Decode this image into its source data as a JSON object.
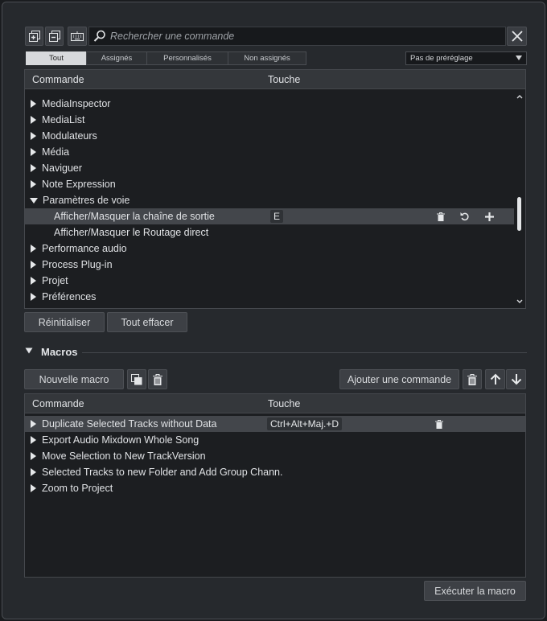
{
  "toolbar": {
    "search_placeholder": "Rechercher une commande"
  },
  "filter_tabs": [
    {
      "label": "Tout",
      "active": true
    },
    {
      "label": "Assignés",
      "active": false
    },
    {
      "label": "Personnalisés",
      "active": false
    },
    {
      "label": "Non assignés",
      "active": false
    }
  ],
  "preset": {
    "selected": "Pas de préréglage"
  },
  "commands_table": {
    "col_command": "Commande",
    "col_key": "Touche",
    "rows": [
      {
        "label": "MediaInspector",
        "expanded": false
      },
      {
        "label": "MediaList",
        "expanded": false
      },
      {
        "label": "Modulateurs",
        "expanded": false
      },
      {
        "label": "Média",
        "expanded": false
      },
      {
        "label": "Naviguer",
        "expanded": false
      },
      {
        "label": "Note Expression",
        "expanded": false
      },
      {
        "label": "Paramètres de voie",
        "expanded": true
      },
      {
        "label": "Afficher/Masquer la chaîne de sortie",
        "child": true,
        "selected": true,
        "key": "E"
      },
      {
        "label": "Afficher/Masquer le Routage direct",
        "child": true
      },
      {
        "label": "Performance audio",
        "expanded": false
      },
      {
        "label": "Process Plug-in",
        "expanded": false
      },
      {
        "label": "Projet",
        "expanded": false
      },
      {
        "label": "Préférences",
        "expanded": false
      }
    ]
  },
  "command_actions": {
    "reset_label": "Réinitialiser",
    "clear_all_label": "Tout effacer"
  },
  "macros": {
    "section_title": "Macros",
    "new_macro_label": "Nouvelle macro",
    "add_command_label": "Ajouter une commande",
    "col_command": "Commande",
    "col_key": "Touche",
    "rows": [
      {
        "label": "Duplicate Selected Tracks without Data",
        "key": "Ctrl+Alt+Maj.+D",
        "selected": true
      },
      {
        "label": "Export Audio Mixdown Whole Song"
      },
      {
        "label": "Move Selection to New TrackVersion"
      },
      {
        "label": "Selected Tracks to new Folder and Add Group Chann."
      },
      {
        "label": "Zoom to Project"
      }
    ],
    "execute_label": "Exécuter la macro"
  }
}
